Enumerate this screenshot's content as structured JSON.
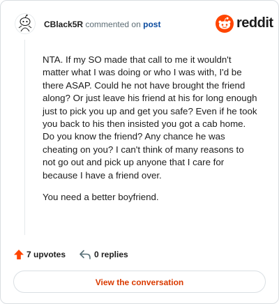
{
  "comment": {
    "author": "CBlack5R",
    "action_text": "commented on",
    "post_link": "post",
    "paragraphs": [
      "NTA. If my SO made that call to me it wouldn't matter what I was doing or who I was with, I'd be there ASAP. Could he not have brought the friend along? Or just leave his friend at his for long enough just to pick you up and get you safe? Even if he took you back to his then insisted you got a cab home. Do you know the friend? Any chance he was cheating on you? I can't think of many reasons to not go out and pick up anyone that I care for because I have a friend over.",
      "You need a better boyfriend."
    ]
  },
  "brand": {
    "name": "reddit",
    "color": "#ff4500"
  },
  "actions": {
    "upvotes": "7 upvotes",
    "replies": "0 replies"
  },
  "footer": {
    "view_button": "View the conversation"
  },
  "colors": {
    "accent": "#d93a00",
    "upvote": "#ff4500",
    "link": "#0a4a9e"
  }
}
